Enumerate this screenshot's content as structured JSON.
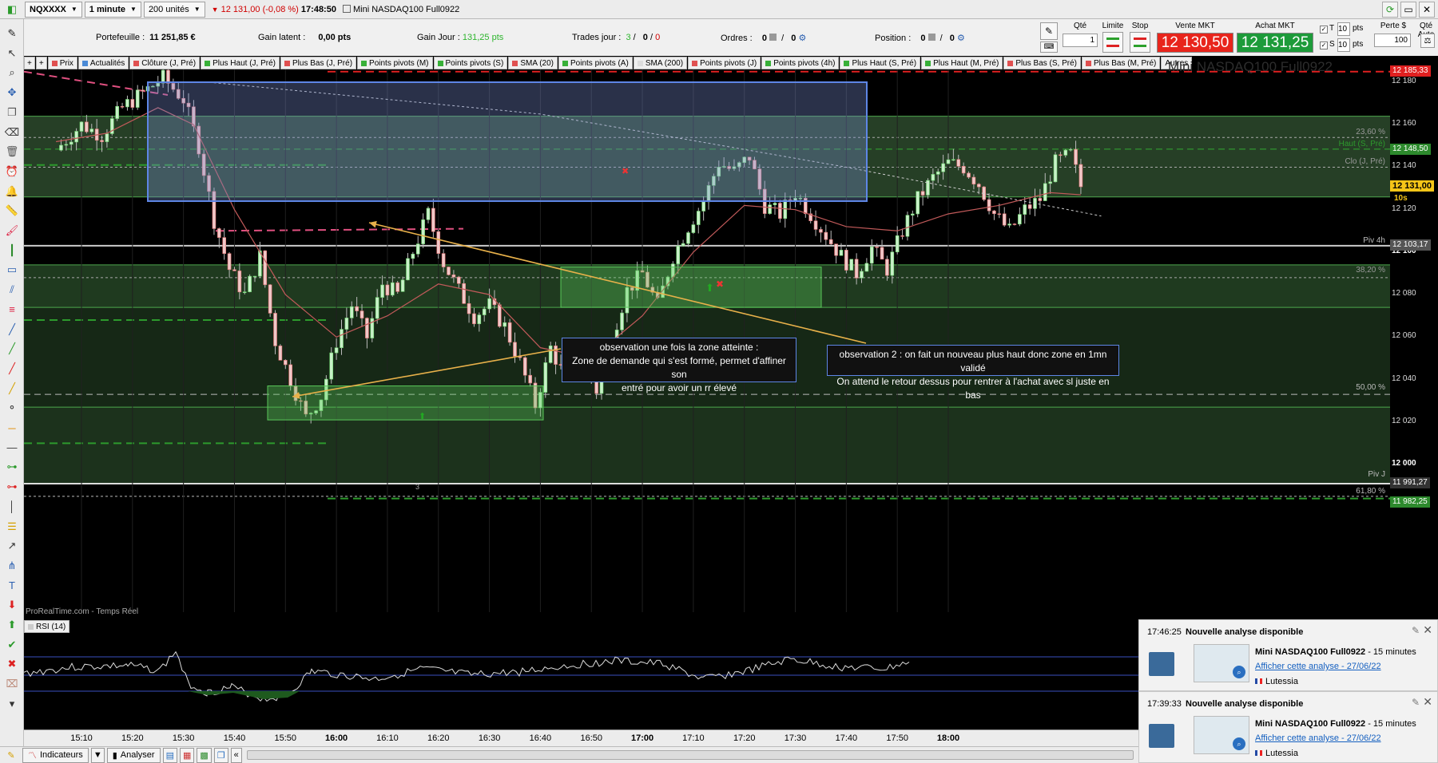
{
  "topbar": {
    "instrument": "NQXXXX",
    "timeframe": "1 minute",
    "units": "200 unités",
    "last_price": "12 131,00",
    "change": "(-0,08 %)",
    "time": "17:48:50",
    "name": "Mini NASDAQ100 Full0922"
  },
  "account": {
    "portfolio_label": "Portefeuille :",
    "portfolio_value": "11 251,85 €",
    "latent_label": "Gain latent :",
    "latent_value": "0,00 pts",
    "day_label": "Gain Jour :",
    "day_value": "131,25 pts",
    "trades_label": "Trades jour :",
    "trades_a": "3",
    "trades_b": "0",
    "trades_c": "0",
    "orders_label": "Ordres :",
    "orders_a": "0",
    "orders_b": "0",
    "position_label": "Position :",
    "position_a": "0",
    "position_b": "0"
  },
  "order_panel": {
    "qty_label": "Qté",
    "qty_value": "1",
    "limit_label": "Limite",
    "stop_label": "Stop",
    "sell_label": "Vente MKT",
    "sell_price": "12 130,50",
    "buy_label": "Achat MKT",
    "buy_price": "12 131,25",
    "t_label": "T",
    "s_label": "S",
    "t_pts": "10",
    "s_pts": "10",
    "pts": "pts",
    "lose_label": "Perte $",
    "lose_value": "100",
    "auto_label": "Qté Auto"
  },
  "tags": [
    {
      "label": "Prix",
      "color": "#e05050"
    },
    {
      "label": "Actualités",
      "color": "#4a8ad6"
    },
    {
      "label": "Clôture (J, Pré)",
      "color": "#e05050"
    },
    {
      "label": "Plus Haut (J, Pré)",
      "color": "#38b038"
    },
    {
      "label": "Plus Bas (J, Pré)",
      "color": "#e05050"
    },
    {
      "label": "Points pivots (M)",
      "color": "#38b038"
    },
    {
      "label": "Points pivots (S)",
      "color": "#38b038"
    },
    {
      "label": "SMA (20)",
      "color": "#e05050"
    },
    {
      "label": "Points pivots (A)",
      "color": "#38b038"
    },
    {
      "label": "SMA (200)",
      "color": "#dddddd"
    },
    {
      "label": "Points pivots (J)",
      "color": "#e05050"
    },
    {
      "label": "Points pivots (4h)",
      "color": "#38b038"
    },
    {
      "label": "Plus Haut (S, Pré)",
      "color": "#38b038"
    },
    {
      "label": "Plus Haut (M, Pré)",
      "color": "#38b038"
    },
    {
      "label": "Plus Bas (S, Pré)",
      "color": "#e05050"
    },
    {
      "label": "Plus Bas (M, Pré)",
      "color": "#e05050"
    },
    {
      "label": "Autres",
      "color": ""
    }
  ],
  "chart": {
    "watermark": "Mini NASDAQ100 Full0922",
    "source": "ProRealTime.com - Temps Réel",
    "annotation1": [
      "observation une fois la zone atteinte :",
      "Zone de demande qui s'est formé, permet d'affiner son",
      "entré pour avoir un rr élevé"
    ],
    "annotation2": [
      "observation 2 : on fait un nouveau plus haut donc zone en 1mn validé",
      "On attend le retour dessus pour rentrer à l'achat avec sl juste en bas"
    ],
    "marker_count": "3"
  },
  "price_axis": {
    "ticks": [
      "12 180",
      "12 160",
      "12 140",
      "12 120",
      "12 100",
      "12 080",
      "12 060",
      "12 040",
      "12 020",
      "12 000"
    ],
    "tags": {
      "top_red": "12 185,33",
      "haut": "12 148,50",
      "current": "12 131,00",
      "timer": "10s",
      "piv4h": "12 103,17",
      "pivj": "11 991,27",
      "bottom_green": "11 982,25"
    },
    "right_labels": {
      "fib236": "23,60 %",
      "haut_s": "Haut (S, Pré)",
      "clo_j": "Clo (J, Pré)",
      "piv4h": "Piv 4h",
      "fib382": "38,20 %",
      "fib50": "50,00 %",
      "pivj": "Piv J",
      "fib618": "61,80 %"
    }
  },
  "rsi": {
    "label": "RSI (14)"
  },
  "time_axis": [
    "15:10",
    "15:20",
    "15:30",
    "15:40",
    "15:50",
    "16:00",
    "16:10",
    "16:20",
    "16:30",
    "16:40",
    "16:50",
    "17:00",
    "17:10",
    "17:20",
    "17:30",
    "17:40",
    "17:50",
    "18:00"
  ],
  "bottombar": {
    "indicators": "Indicateurs",
    "analyze": "Analyser"
  },
  "notifications": [
    {
      "time": "17:46:25",
      "title": "Nouvelle analyse disponible",
      "instrument": "Mini NASDAQ100 Full0922",
      "period": " - 15 minutes",
      "link": "Afficher cette analyse - 27/06/22",
      "author": "Lutessia"
    },
    {
      "time": "17:39:33",
      "title": "Nouvelle analyse disponible",
      "instrument": "Mini NASDAQ100 Full0922",
      "period": " - 15 minutes",
      "link": "Afficher cette analyse - 27/06/22",
      "author": "Lutessia"
    }
  ]
}
